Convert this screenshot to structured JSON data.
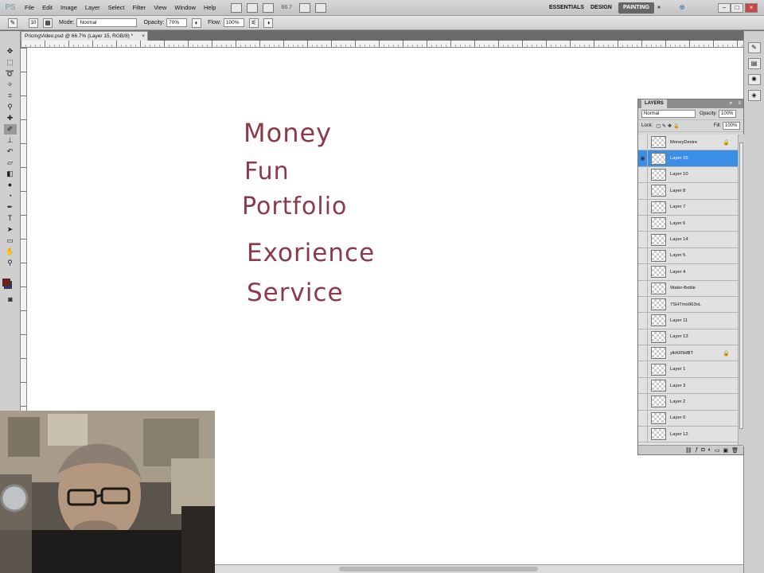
{
  "app": {
    "logo": "PS"
  },
  "menu": [
    "File",
    "Edit",
    "Image",
    "Layer",
    "Select",
    "Filter",
    "View",
    "Window",
    "Help"
  ],
  "zoom_display": "66.7",
  "workspaces": [
    "ESSENTIALS",
    "DESIGN",
    "PAINTING"
  ],
  "options": {
    "mode_label": "Mode:",
    "mode_value": "Normal",
    "opacity_label": "Opacity:",
    "opacity_value": "70%",
    "flow_label": "Flow:",
    "flow_value": "100%",
    "brush_size": "10"
  },
  "document": {
    "tab_title": "PricingVideo.psd @ 66.7% (Layer 15, RGB/8) *",
    "close": "×"
  },
  "canvas_words": [
    "Money",
    "Fun",
    "Portfolio",
    "Exorience",
    "Service"
  ],
  "layers_panel": {
    "title": "LAYERS",
    "blend_mode": "Normal",
    "opacity_label": "Opacity:",
    "opacity_value": "100%",
    "lock_label": "Lock:",
    "fill_label": "Fill:",
    "fill_value": "100%",
    "layers": [
      {
        "name": "MoneyDesire",
        "locked": true,
        "selected": false
      },
      {
        "name": "Layer 15",
        "locked": false,
        "selected": true
      },
      {
        "name": "Layer 10",
        "locked": false,
        "selected": false
      },
      {
        "name": "Layer 8",
        "locked": false,
        "selected": false
      },
      {
        "name": "Layer 7",
        "locked": false,
        "selected": false
      },
      {
        "name": "Layer 6",
        "locked": false,
        "selected": false
      },
      {
        "name": "Layer 14",
        "locked": false,
        "selected": false
      },
      {
        "name": "Layer 5",
        "locked": false,
        "selected": false
      },
      {
        "name": "Layer 4",
        "locked": false,
        "selected": false
      },
      {
        "name": "Water-Bottle",
        "locked": false,
        "selected": false
      },
      {
        "name": "7SHTmo963oL",
        "locked": false,
        "selected": false
      },
      {
        "name": "Layer 11",
        "locked": false,
        "selected": false
      },
      {
        "name": "Layer 13",
        "locked": false,
        "selected": false
      },
      {
        "name": "yikKR9dBT",
        "locked": true,
        "selected": false
      },
      {
        "name": "Layer 1",
        "locked": false,
        "selected": false
      },
      {
        "name": "Layer 3",
        "locked": false,
        "selected": false
      },
      {
        "name": "Layer 2",
        "locked": false,
        "selected": false
      },
      {
        "name": "Layer 0",
        "locked": false,
        "selected": false
      },
      {
        "name": "Layer 12",
        "locked": false,
        "selected": false
      }
    ]
  },
  "colors": {
    "ink": "#8c3a47",
    "foreground": "#7a1a1a",
    "background": "#2a3a8a",
    "selection": "#3a8ee6"
  },
  "icons": {
    "tools": [
      "move-icon",
      "marquee-icon",
      "lasso-icon",
      "quick-select-icon",
      "crop-icon",
      "eyedropper-icon",
      "healing-icon",
      "brush-icon",
      "stamp-icon",
      "history-brush-icon",
      "eraser-icon",
      "gradient-icon",
      "blur-icon",
      "dodge-icon",
      "pen-icon",
      "type-icon",
      "path-select-icon",
      "shape-icon",
      "hand-icon",
      "zoom-icon"
    ]
  }
}
